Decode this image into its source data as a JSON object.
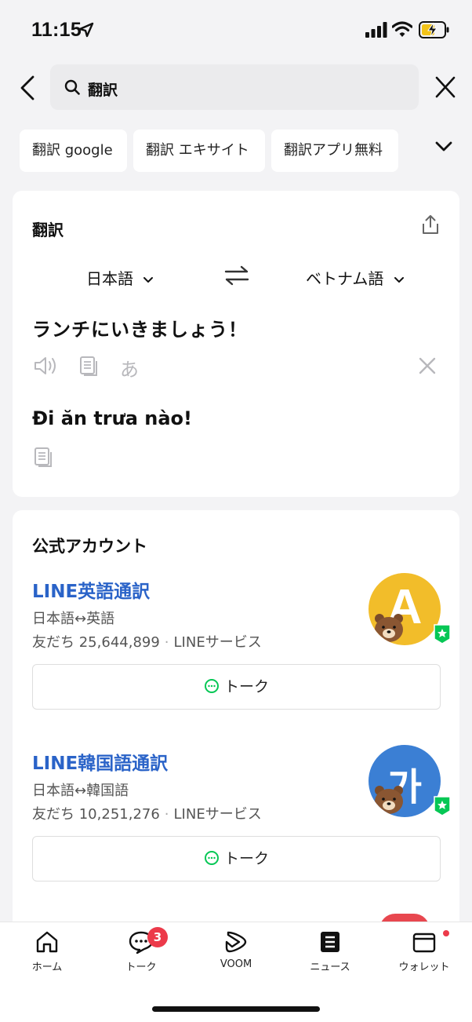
{
  "status_bar": {
    "time": "11:15"
  },
  "search": {
    "query": "翻訳"
  },
  "suggestions": [
    "翻訳 google",
    "翻訳 エキサイト",
    "翻訳アプリ無料"
  ],
  "translator": {
    "title": "翻訳",
    "source_lang": "日本語",
    "target_lang": "ベトナム語",
    "source_text": "ランチにいきましょう！",
    "kana_label": "あ",
    "translated_text": "Đi ăn trưa nào!"
  },
  "official_accounts": {
    "heading": "公式アカウント",
    "items": [
      {
        "name": "LINE英語通訳",
        "description": "日本語↔英語",
        "friends_label": "友だち",
        "friends_count": "25,644,899",
        "service": "LINEサービス",
        "avatar_letter": "A",
        "avatar_color": "#f2bd2a",
        "button_label": "トーク"
      },
      {
        "name": "LINE韓国語通訳",
        "description": "日本語↔韓国語",
        "friends_label": "友だち",
        "friends_count": "10,251,276",
        "service": "LINEサービス",
        "avatar_letter": "가",
        "avatar_color": "#3b7fd4",
        "button_label": "トーク"
      }
    ]
  },
  "bottom_nav": {
    "items": [
      {
        "label": "ホーム",
        "icon": "home-icon"
      },
      {
        "label": "トーク",
        "icon": "chat-icon",
        "badge": "3"
      },
      {
        "label": "VOOM",
        "icon": "voom-icon"
      },
      {
        "label": "ニュース",
        "icon": "news-icon"
      },
      {
        "label": "ウォレット",
        "icon": "wallet-icon"
      }
    ]
  },
  "colors": {
    "link_blue": "#2a63c8",
    "badge_red": "#ec3a4a",
    "line_green": "#06c755"
  }
}
